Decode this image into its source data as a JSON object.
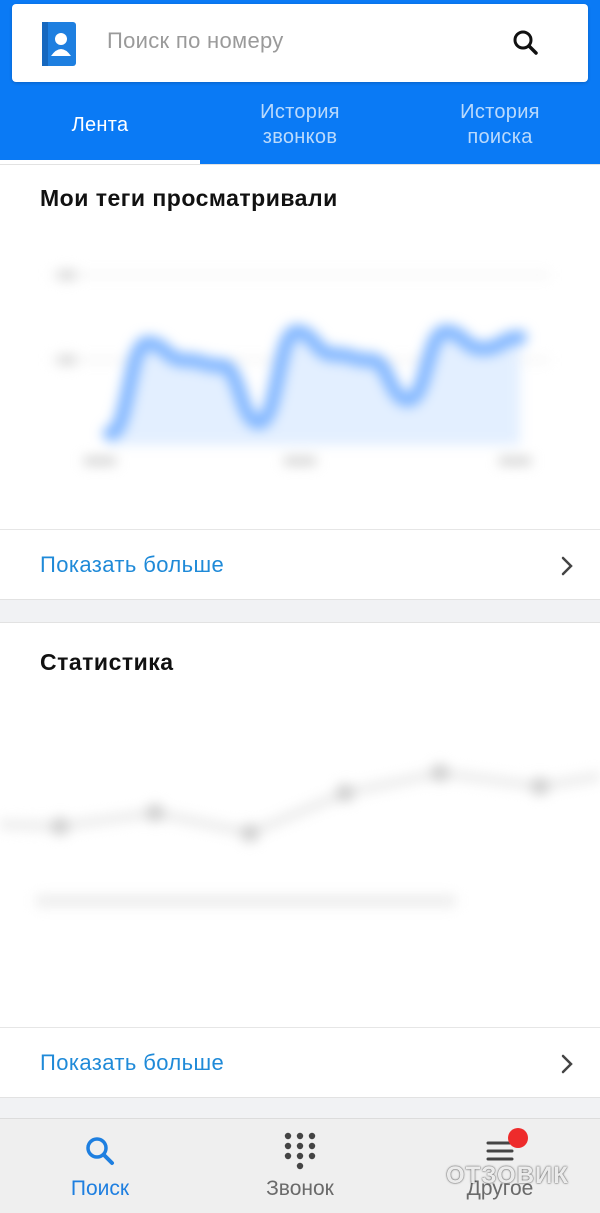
{
  "search": {
    "placeholder": "Поиск по номеру"
  },
  "tabs": [
    {
      "label": "Лента",
      "active": true
    },
    {
      "label": "История звонков",
      "active": false
    },
    {
      "label": "История поиска",
      "active": false
    }
  ],
  "cards": {
    "tags_viewed": {
      "title": "Мои теги просматривали",
      "show_more": "Показать больше"
    },
    "statistics": {
      "title": "Статистика",
      "show_more": "Показать больше"
    }
  },
  "bottom_nav": [
    {
      "label": "Поиск",
      "icon": "search-icon",
      "active": true
    },
    {
      "label": "Звонок",
      "icon": "dialpad-icon",
      "active": false
    },
    {
      "label": "Другое",
      "icon": "menu-icon",
      "active": false,
      "has_badge": true
    }
  ],
  "watermark": "ОТЗОВИК",
  "colors": {
    "primary": "#0a7af5",
    "link": "#1f8ad8",
    "badge": "#ee2b2b"
  },
  "chart_data": [
    {
      "type": "area",
      "note_blurred": true,
      "values": [
        2,
        18,
        15,
        14,
        4,
        20,
        16,
        15,
        8,
        20,
        17,
        19
      ],
      "ylim": [
        0,
        30
      ]
    },
    {
      "type": "line",
      "note_blurred": true,
      "values": [
        4,
        6,
        3,
        9,
        12,
        10
      ],
      "ylim": [
        0,
        15
      ]
    }
  ]
}
